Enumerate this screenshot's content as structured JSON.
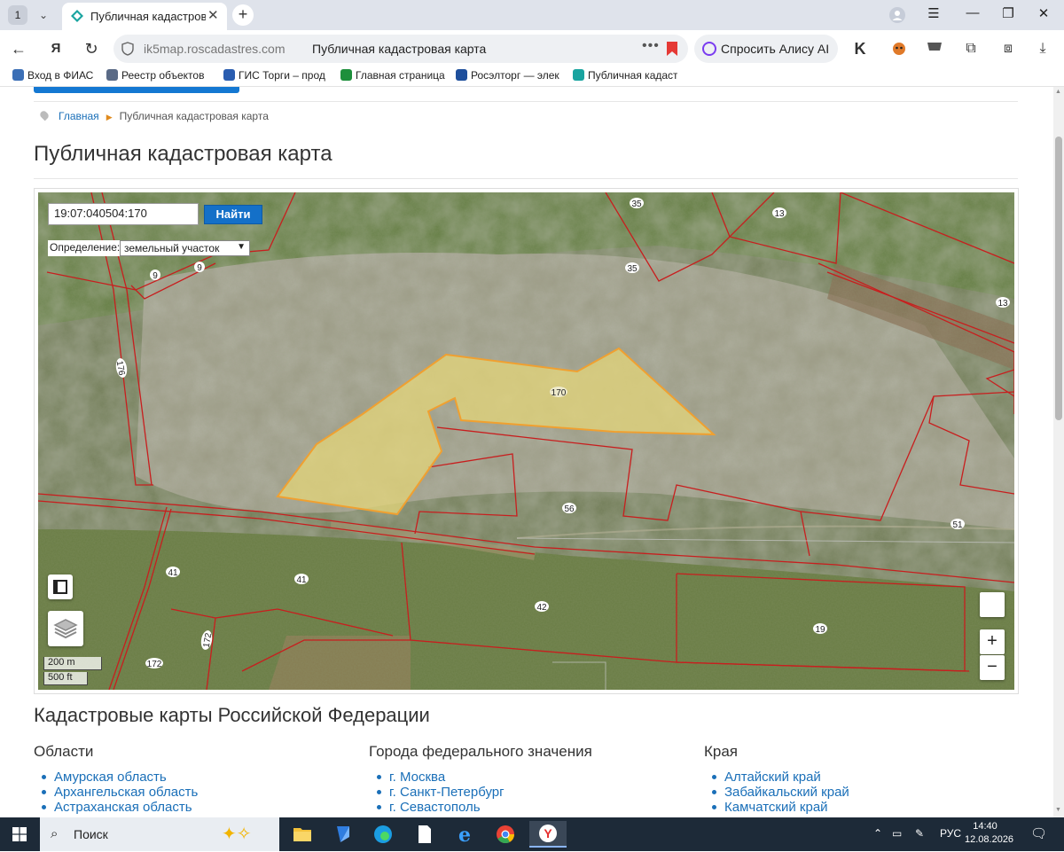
{
  "browser": {
    "tab_counter": "1",
    "tab_title": "Публичная кадастров",
    "url_domain": "ik5map.roscadastres.com",
    "url_title": "Публичная кадастровая карта",
    "alice_label": "Спросить Алису AI",
    "bookmarks": [
      {
        "label": "Вход в ФИАС",
        "color": "#3b6fb6"
      },
      {
        "label": "Реестр объектов",
        "color": "#5a6a86"
      },
      {
        "label": "ГИС Торги – прод",
        "color": "#2a5db0"
      },
      {
        "label": "Главная страница",
        "color": "#1d8f3b"
      },
      {
        "label": "Росэлторг — элек",
        "color": "#1e4f9c"
      },
      {
        "label": "Публичная кадаст",
        "color": "#19a4a0"
      }
    ]
  },
  "page": {
    "breadcrumb": {
      "home": "Главная",
      "current": "Публичная кадастровая карта"
    },
    "title": "Публичная кадастровая карта",
    "map": {
      "search_value": "19:07:040504:170",
      "search_button": "Найти",
      "definition_label": "Определение:",
      "definition_value": "земельный участок",
      "scale_metric": "200 m",
      "scale_imperial": "500 ft",
      "zoom_in": "+",
      "zoom_out": "−",
      "selected_parcel": "170",
      "parcel_labels": [
        "35",
        "13",
        "9",
        "9",
        "35",
        "13",
        "176",
        "170",
        "56",
        "51",
        "41",
        "41",
        "42",
        "19",
        "172",
        "172"
      ],
      "colors": {
        "boundary": "#c81e1e",
        "selected_fill": "#e8d878",
        "selected_stroke": "#f0a030"
      }
    },
    "section_title": "Кадастровые карты Российской Федерации",
    "columns": [
      {
        "title": "Области",
        "items": [
          "Амурская область",
          "Архангельская область",
          "Астраханская область"
        ]
      },
      {
        "title": "Города федерального значения",
        "items": [
          "г. Москва",
          "г. Санкт-Петербург",
          "г. Севастополь"
        ]
      },
      {
        "title": "Края",
        "items": [
          "Алтайский край",
          "Забайкальский край",
          "Камчатский край"
        ]
      }
    ]
  },
  "taskbar": {
    "search_label": "Поиск",
    "language": "РУС",
    "time": "14:40",
    "date": "12.08.2026"
  }
}
